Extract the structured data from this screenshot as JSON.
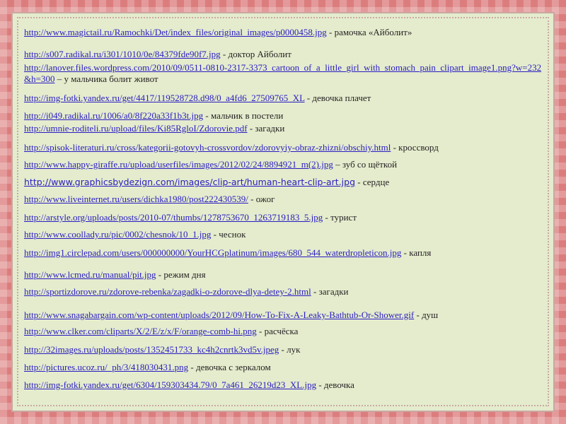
{
  "entries": [
    {
      "url": "http://www.magictail.ru/Ramochki/Det/index_files/original_images/p0000458.jpg",
      "desc": " - рамочка «Айболит»"
    },
    {
      "url": "http://s007.radikal.ru/i301/1010/0e/84379fde90f7.jpg",
      "desc": " - доктор Айболит"
    },
    {
      "url": "http://lanover.files.wordpress.com/2010/09/0511-0810-2317-3373_cartoon_of_a_little_girl_with_stomach_pain_clipart_image1.png?w=232&h=300",
      "desc": " – у мальчика болит живот"
    },
    {
      "url": "http://img-fotki.yandex.ru/get/4417/119528728.d98/0_a4fd6_27509765_XL",
      "desc": " - девочка плачет"
    },
    {
      "url": "http://i049.radikal.ru/1006/a0/8f220a33f1b3t.jpg",
      "desc": " - мальчик в постели"
    },
    {
      "url": "http://umnie-roditeli.ru/upload/files/Ki85RgloI/Zdorovie.pdf",
      "desc": " - загадки"
    },
    {
      "url": "http://spisok-literaturi.ru/cross/kategorii-gotovyh-crossvordov/zdorovyiy-obraz-zhizni/obschiy.html",
      "desc": " - кроссворд"
    },
    {
      "url": "http://www.happy-giraffe.ru/upload/userfiles/images/2012/02/24/8894921_m(2).jpg",
      "desc": " – зуб со щёткой"
    },
    {
      "url": "http://www.graphicsbydezign.com/images/clip-art/human-heart-clip-art.jpg",
      "desc": " - сердце"
    },
    {
      "url": "http://www.liveinternet.ru/users/dichka1980/post222430539/",
      "desc": " - ожог"
    },
    {
      "url": "http://arstyle.org/uploads/posts/2010-07/thumbs/1278753670_1263719183_5.jpg",
      "desc": " - турист"
    },
    {
      "url": "http://www.coollady.ru/pic/0002/chesnok/10_1.jpg",
      "desc": " - чеснок"
    },
    {
      "url": "http://img1.circlepad.com/users/000000000/YourHCGplatinum/images/680_544_waterdropleticon.jpg",
      "desc": " - капля"
    },
    {
      "url": "http://www.lcmed.ru/manual/pit.jpg",
      "desc": " - режим дня"
    },
    {
      "url": "http://sportizdorove.ru/zdorove-rebenka/zagadki-o-zdorove-dlya-detey-2.html",
      "desc": " - загадки"
    },
    {
      "url": "http://www.snagabargain.com/wp-content/uploads/2012/09/How-To-Fix-A-Leaky-Bathtub-Or-Shower.gif",
      "desc": " - душ"
    },
    {
      "url": "http://www.clker.com/cliparts/X/2/E/z/x/F/orange-comb-hi.png",
      "desc": " - расчёска"
    },
    {
      "url": "http://32images.ru/uploads/posts/1352451733_kc4h2cnrtk3vd5v.jpeg",
      "desc": " - лук"
    },
    {
      "url": "http://pictures.ucoz.ru/_ph/3/418030431.png",
      "desc": " - девочка с зеркалом"
    },
    {
      "url": "http://img-fotki.yandex.ru/get/6304/159303434.79/0_7a461_26219d23_XL.jpg",
      "desc": " - девочка"
    }
  ],
  "colors": {
    "link": "#2a1cc1",
    "text": "#231f20",
    "panel": "#e4eccd",
    "background": "#dc7d7d"
  }
}
